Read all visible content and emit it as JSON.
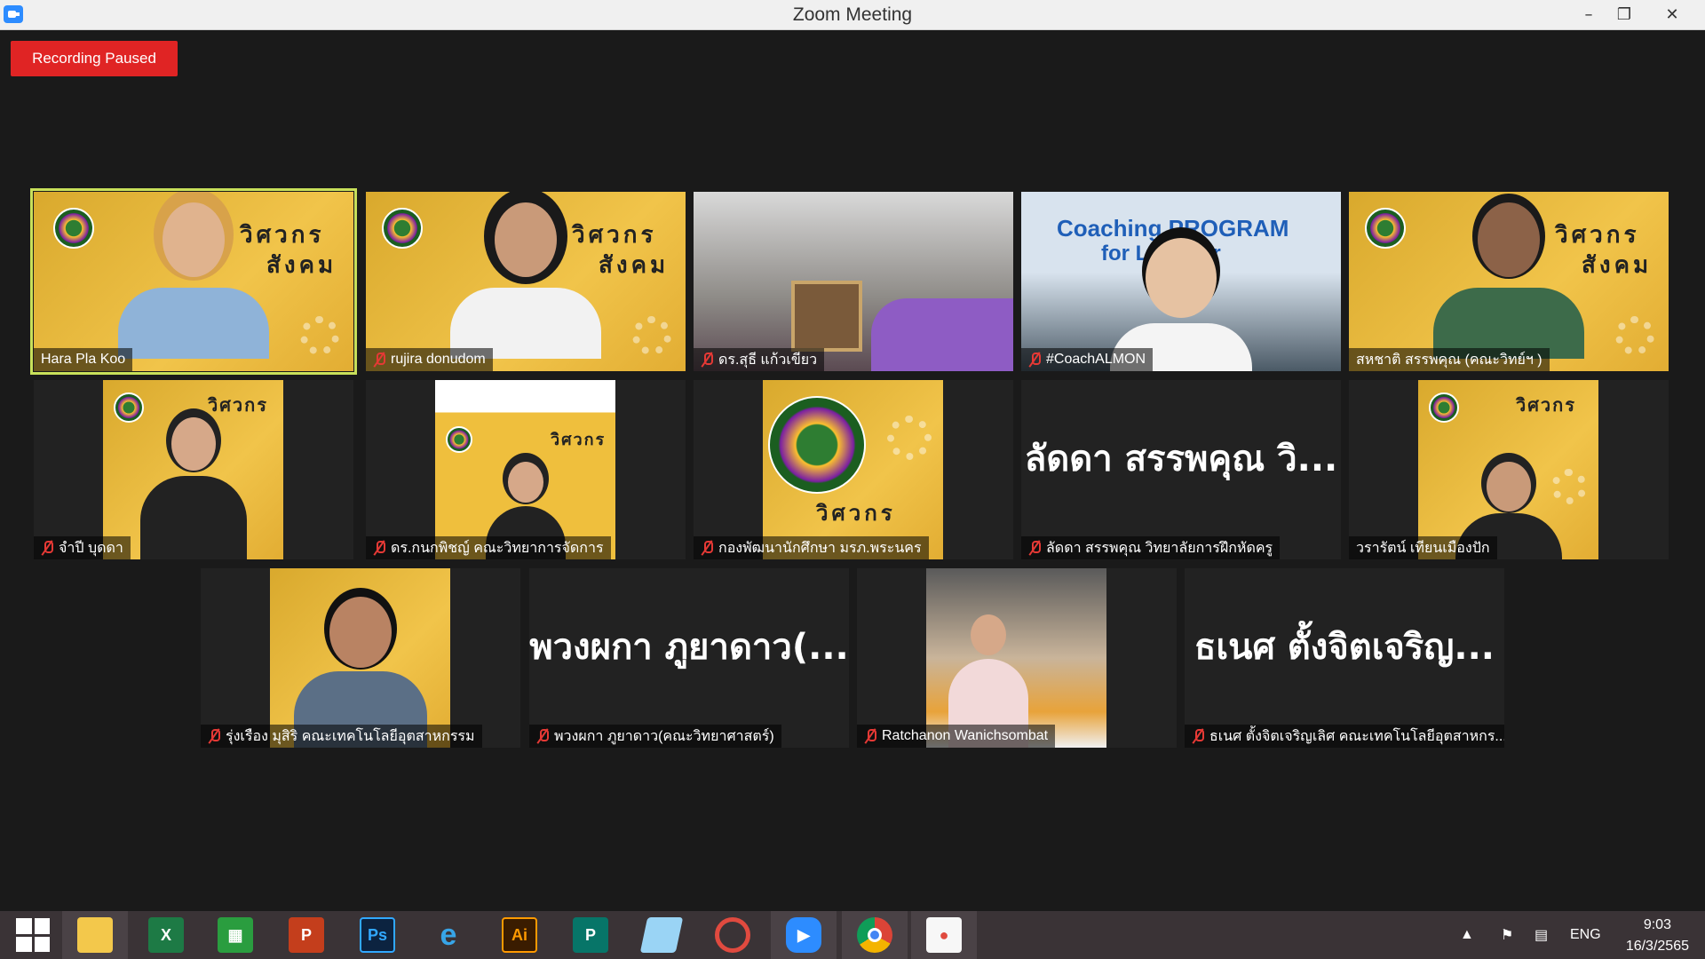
{
  "window": {
    "title": "Zoom Meeting"
  },
  "recording": {
    "label": "Recording Paused"
  },
  "participants": [
    {
      "name": "Hara Pla Koo",
      "muted": false,
      "active": true
    },
    {
      "name": "rujira donudom",
      "muted": true
    },
    {
      "name": "ดร.สุธี แก้วเขียว",
      "muted": true
    },
    {
      "name": "#CoachALMON",
      "muted": true,
      "banner": "Coaching PROGRAM",
      "banner2": "for Lecturer"
    },
    {
      "name": "สหชาติ สรรพคุณ (คณะวิทย์ฯ )",
      "muted": false
    },
    {
      "name": "จำปี บุดดา",
      "muted": true
    },
    {
      "name": "ดร.กนกพิชญ์ คณะวิทยาการจัดการ",
      "muted": true
    },
    {
      "name": "กองพัฒนานักศึกษา มรภ.พระนคร",
      "muted": true
    },
    {
      "name": "ลัดดา สรรพคุณ วิทยาลัยการฝึกหัดครู",
      "muted": true,
      "display": "ลัดดา สรรพคุณ วิ..."
    },
    {
      "name": "วรารัตน์ เทียนเมืองปัก",
      "muted": false
    },
    {
      "name": "รุ่งเรือง มุสิริ คณะเทคโนโลยีอุตสาหกรรม",
      "muted": true
    },
    {
      "name": "พวงผกา ภูยาดาว(คณะวิทยาศาสตร์)",
      "muted": true,
      "display": "พวงผกา ภูยาดาว(..."
    },
    {
      "name": "Ratchanon Wanichsombat",
      "muted": true
    },
    {
      "name": "ธเนศ ตั้งจิตเจริญเลิศ คณะเทคโนโลยีอุตสาหกร...",
      "muted": true,
      "display": "ธเนศ ตั้งจิตเจริญ..."
    }
  ],
  "virtual_background": {
    "title": "วิศวกร",
    "subtitle": "สังคม"
  },
  "taskbar": {
    "apps": [
      "start",
      "file-explorer",
      "excel",
      "store",
      "powerpoint",
      "photoshop",
      "internet-explorer",
      "illustrator",
      "publisher",
      "notepad",
      "hotocape",
      "zoom",
      "chrome",
      "paint"
    ],
    "labels": {
      "excel": "X",
      "ps": "Ps",
      "ai": "Ai",
      "ppt": "P",
      "pub": "P"
    },
    "language": "ENG",
    "time": "9:03",
    "date": "16/3/2565"
  },
  "colors": {
    "recording": "#e02424",
    "active_speaker": "#c8e05a",
    "muted": "#e53935",
    "taskbar": "#3a3336"
  }
}
